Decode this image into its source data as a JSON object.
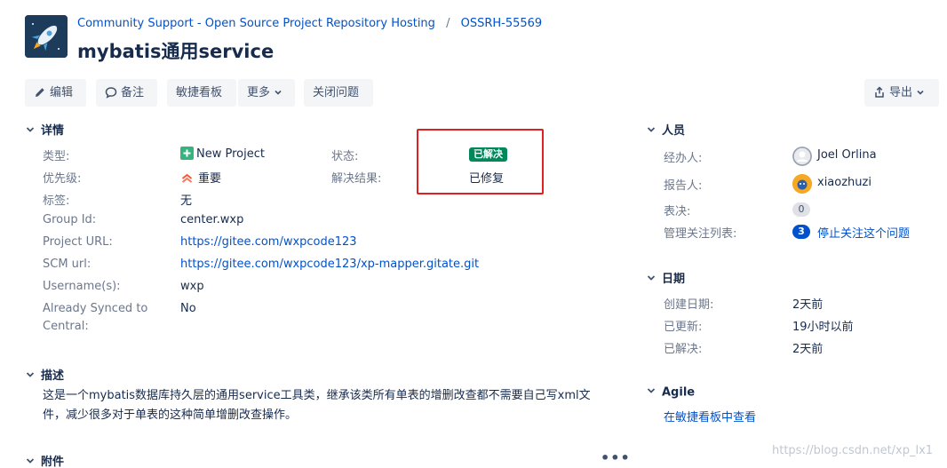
{
  "header": {
    "project_name": "Community Support - Open Source Project Repository Hosting",
    "separator": "/",
    "issue_key": "OSSRH-55569",
    "title": "mybatis通用service"
  },
  "toolbar": {
    "edit": "编辑",
    "comment": "备注",
    "agile_board": "敏捷看板",
    "more": "更多",
    "close_issue": "关闭问题",
    "export": "导出"
  },
  "details": {
    "heading": "详情",
    "type_label": "类型:",
    "type_value": "New Project",
    "priority_label": "优先级:",
    "priority_value": "重要",
    "tags_label": "标签:",
    "tags_value": "无",
    "group_id_label": "Group Id:",
    "group_id_value": "center.wxp",
    "project_url_label": "Project URL:",
    "project_url_value": "https://gitee.com/wxpcode123",
    "scm_url_label": "SCM url:",
    "scm_url_value": "https://gitee.com/wxpcode123/xp-mapper.gitate.git",
    "username_label": "Username(s):",
    "username_value": "wxp",
    "synced_label_line1": "Already Synced to",
    "synced_label_line2": "Central:",
    "synced_value": "No",
    "status_label": "状态:",
    "status_value": "已解决",
    "resolution_label": "解决结果:",
    "resolution_value": "已修复"
  },
  "people": {
    "heading": "人员",
    "assignee_label": "经办人:",
    "assignee_value": "Joel Orlina",
    "reporter_label": "报告人:",
    "reporter_value": "xiaozhuzi",
    "votes_label": "表决:",
    "votes_value": "0",
    "watchers_label": "管理关注列表:",
    "watchers_count": "3",
    "watchers_action": "停止关注这个问题"
  },
  "dates": {
    "heading": "日期",
    "created_label": "创建日期:",
    "created_value": "2天前",
    "updated_label": "已更新:",
    "updated_value": "19小时以前",
    "resolved_label": "已解决:",
    "resolved_value": "2天前"
  },
  "description": {
    "heading": "描述",
    "text": "这是一个mybatis数据库持久层的通用service工具类，继承该类所有单表的增删改查都不需要自己写xml文件，减少很多对于单表的这种简单增删改查操作。"
  },
  "agile": {
    "heading": "Agile",
    "link": "在敏捷看板中查看"
  },
  "attachments": {
    "heading": "附件",
    "more": "•••"
  },
  "watermark": "https://blog.csdn.net/xp_lx1",
  "colors": {
    "link": "#0052cc",
    "status_green": "#00875a",
    "highlight_red": "#e02020",
    "button_bg": "#f4f5f7"
  }
}
